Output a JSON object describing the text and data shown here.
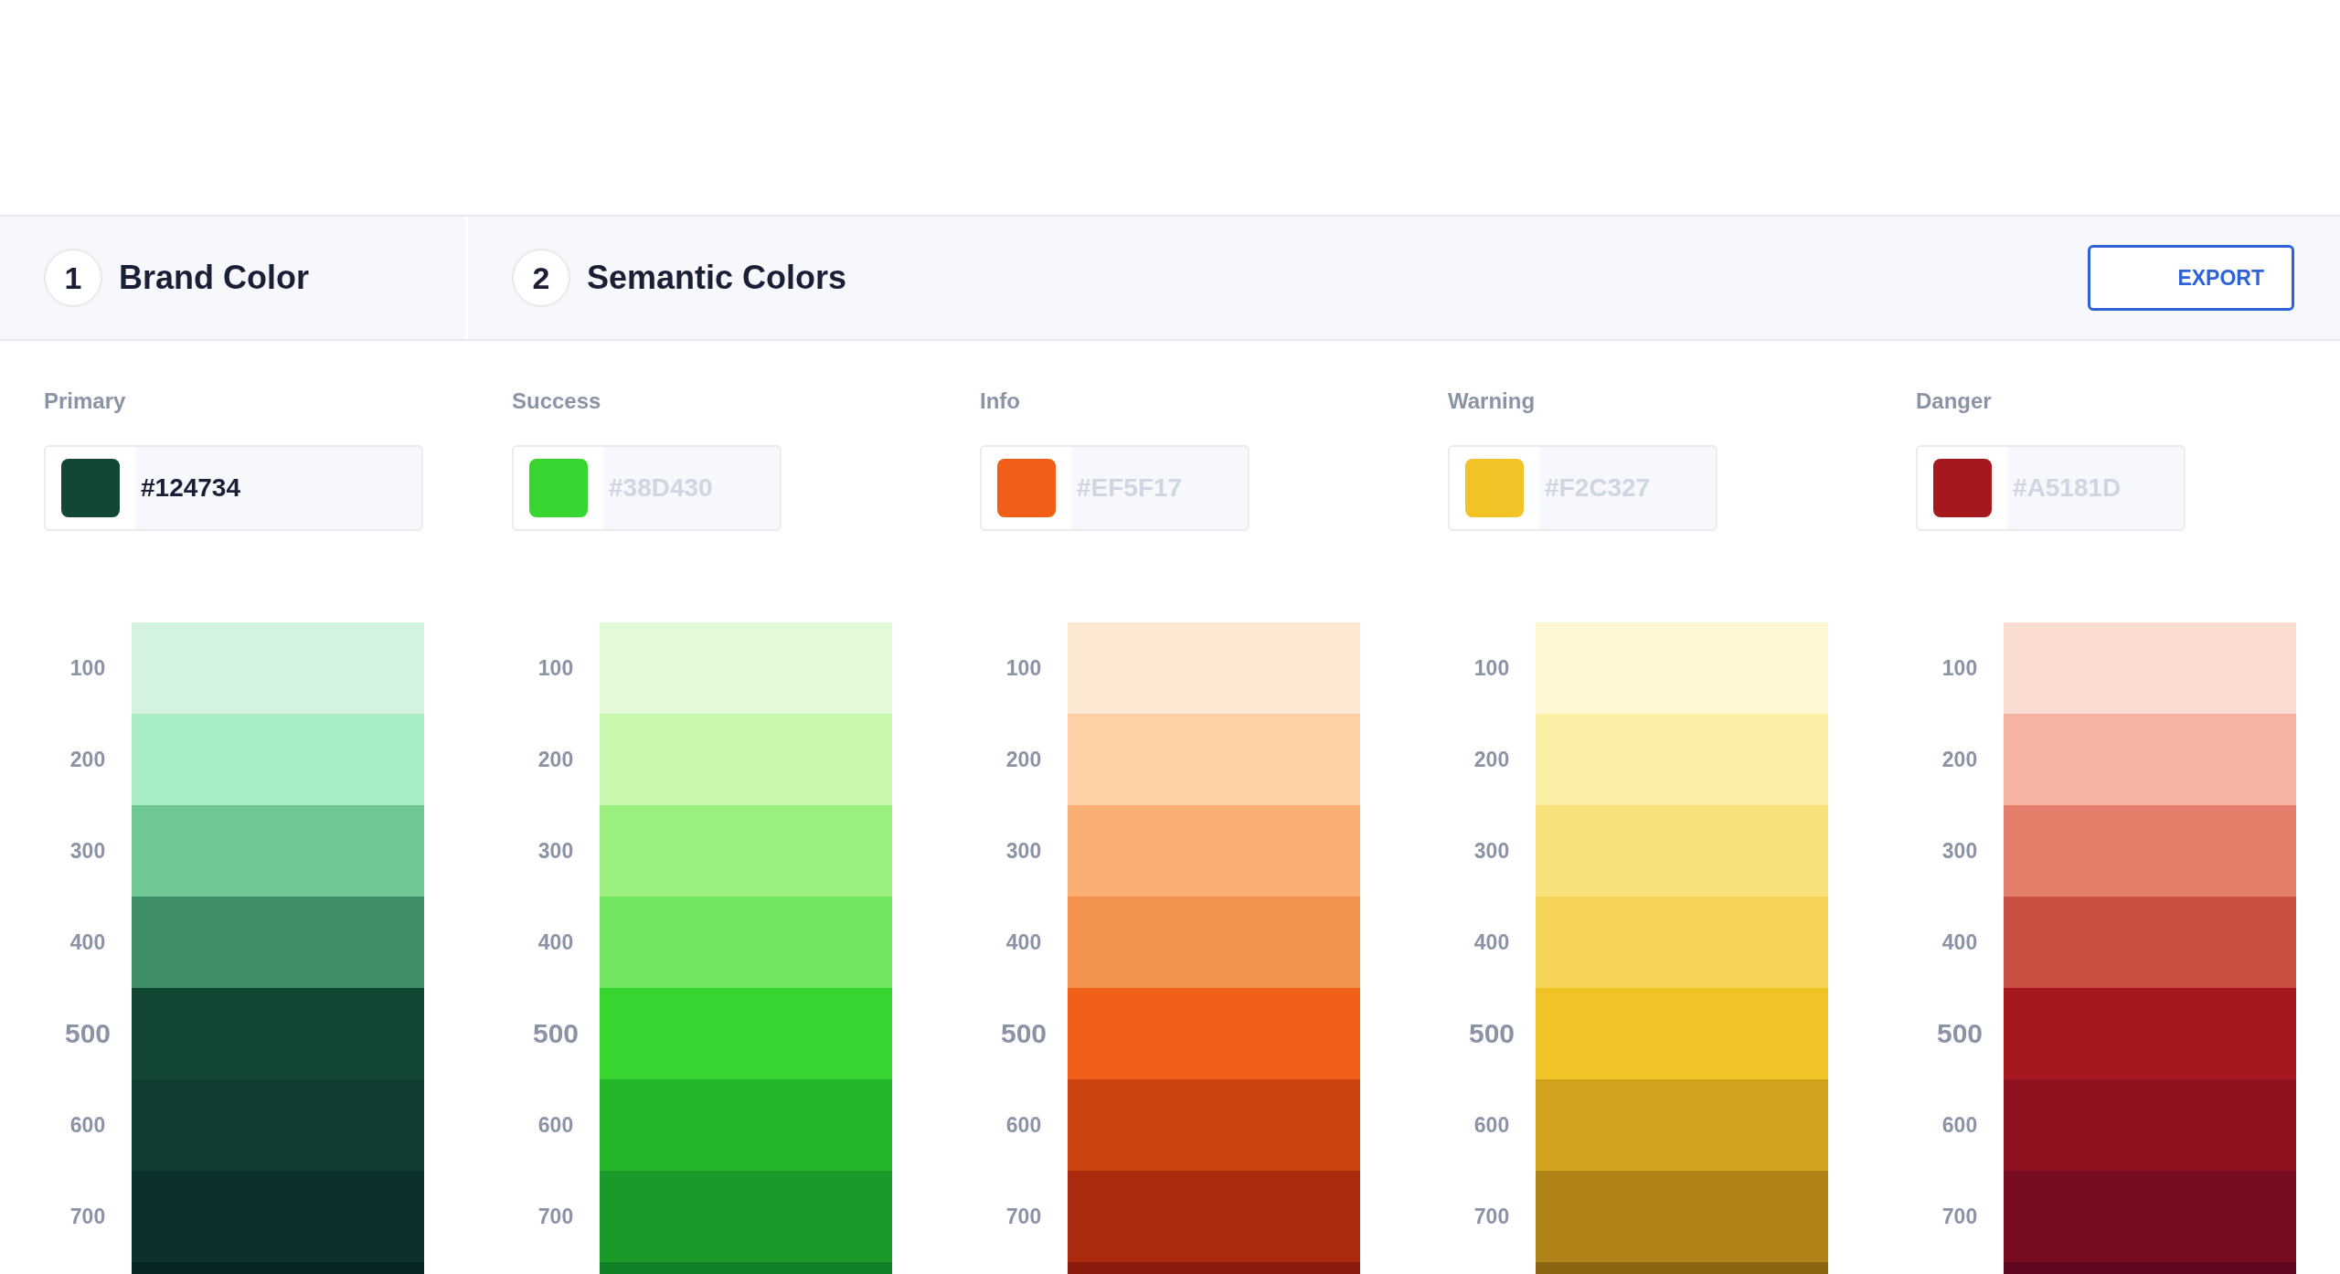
{
  "steps": [
    {
      "number": "1",
      "title": "Brand Color"
    },
    {
      "number": "2",
      "title": "Semantic Colors"
    }
  ],
  "export_button": "EXPORT",
  "palettes": [
    {
      "label": "Primary",
      "field": {
        "value": "#124734"
      },
      "color": "#124734",
      "shades": [
        {
          "label": "100",
          "base": false,
          "color": "#d3f3e0"
        },
        {
          "label": "200",
          "base": false,
          "color": "#a8ecc3"
        },
        {
          "label": "300",
          "base": false,
          "color": "#6fc796"
        },
        {
          "label": "400",
          "base": false,
          "color": "#3f9069"
        },
        {
          "label": "500",
          "base": true,
          "color": "#124734"
        },
        {
          "label": "600",
          "base": false,
          "color": "#0f3d32"
        },
        {
          "label": "700",
          "base": false,
          "color": "#0b302d"
        },
        {
          "color": "#072523"
        }
      ]
    },
    {
      "label": "Success",
      "field": {
        "placeholder": "#38D430"
      },
      "color": "#38d430",
      "shades": [
        {
          "label": "100",
          "base": false,
          "color": "#e3fad9"
        },
        {
          "label": "200",
          "base": false,
          "color": "#c8f8ad"
        },
        {
          "label": "300",
          "base": false,
          "color": "#9bef7f"
        },
        {
          "label": "400",
          "base": false,
          "color": "#72e663"
        },
        {
          "label": "500",
          "base": true,
          "color": "#38d430"
        },
        {
          "label": "600",
          "base": false,
          "color": "#23b52a"
        },
        {
          "label": "700",
          "base": false,
          "color": "#1a9a29"
        },
        {
          "color": "#117f26"
        }
      ]
    },
    {
      "label": "Info",
      "field": {
        "placeholder": "#EF5F17"
      },
      "color": "#ef5f17",
      "shades": [
        {
          "label": "100",
          "base": false,
          "color": "#fde8d1"
        },
        {
          "label": "200",
          "base": false,
          "color": "#fdd1a5"
        },
        {
          "label": "300",
          "base": false,
          "color": "#f9ae73"
        },
        {
          "label": "400",
          "base": false,
          "color": "#f3914f"
        },
        {
          "label": "500",
          "base": true,
          "color": "#ef5f17"
        },
        {
          "label": "600",
          "base": false,
          "color": "#cc4410"
        },
        {
          "label": "700",
          "base": false,
          "color": "#ab2b0e"
        },
        {
          "color": "#8a1a0c"
        }
      ]
    },
    {
      "label": "Warning",
      "field": {
        "placeholder": "#F2C327"
      },
      "color": "#f2c327",
      "shades": [
        {
          "label": "100",
          "base": false,
          "color": "#fdf8d1"
        },
        {
          "label": "200",
          "base": false,
          "color": "#fbefa6"
        },
        {
          "label": "300",
          "base": false,
          "color": "#f8e17b"
        },
        {
          "label": "400",
          "base": false,
          "color": "#f6d45a"
        },
        {
          "label": "500",
          "base": true,
          "color": "#f2c327"
        },
        {
          "label": "600",
          "base": false,
          "color": "#d1a21e"
        },
        {
          "label": "700",
          "base": false,
          "color": "#af8317"
        },
        {
          "color": "#8c6512"
        }
      ]
    },
    {
      "label": "Danger",
      "field": {
        "placeholder": "#A5181D"
      },
      "color": "#a5181d",
      "shades": [
        {
          "label": "100",
          "base": false,
          "color": "#fadcd0"
        },
        {
          "label": "200",
          "base": false,
          "color": "#f5b3a1"
        },
        {
          "label": "300",
          "base": false,
          "color": "#e57d6b"
        },
        {
          "label": "400",
          "base": false,
          "color": "#cb5044"
        },
        {
          "label": "500",
          "base": true,
          "color": "#a5181d"
        },
        {
          "label": "600",
          "base": false,
          "color": "#8e1120"
        },
        {
          "label": "700",
          "base": false,
          "color": "#770c21"
        },
        {
          "color": "#5f0820"
        }
      ]
    }
  ]
}
